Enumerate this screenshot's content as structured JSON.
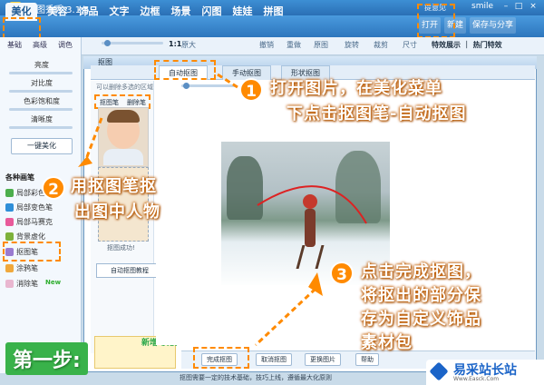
{
  "app": {
    "title": "美图秀秀 3.1.5",
    "user_label": "提意见",
    "user_name": "smile"
  },
  "top_menu": {
    "tabs": [
      "美化",
      "美容",
      "饰品",
      "文字",
      "边框",
      "场景",
      "闪图",
      "娃娃",
      "拼图"
    ],
    "active": "美化"
  },
  "right_tools": {
    "open": "打开",
    "new": "新建",
    "save_share": "保存与分享"
  },
  "toolbar": {
    "scale": "1:1",
    "original": "原大",
    "undo": "撤销",
    "redo": "重做",
    "restore": "原图",
    "rotate": "旋转",
    "crop": "裁剪",
    "size": "尺寸"
  },
  "side_tabs": {
    "recommend": "特效展示 ｜ 热门特效"
  },
  "left_panel": {
    "tabs": [
      "基础",
      "高级",
      "调色"
    ],
    "sliders": [
      "亮度",
      "对比度",
      "色彩饱和度",
      "清晰度"
    ],
    "one_key": "一键美化",
    "brush_title": "各种画笔",
    "brushes": [
      "局部彩色笔",
      "局部变色笔",
      "局部马赛克",
      "背景虚化",
      "抠图笔",
      "涂鸦笔",
      "消除笔"
    ],
    "new_badge": "New"
  },
  "dialog": {
    "title": "抠图",
    "tabs": [
      "自动抠图",
      "手动抠图",
      "形状抠图"
    ],
    "hint": "可以删除多选的区域",
    "sample_tabs": [
      "抠图笔",
      "删除笔"
    ],
    "done_text": "抠图成功!",
    "tutorial": "自动抠图教程",
    "promo": "新增 模板"
  },
  "bottom_bar": {
    "complete": "完成抠图",
    "cancel": "取消抠图",
    "change_bg": "更换图片",
    "other": "帮助"
  },
  "status": "抠图需要一定的技术基础，技巧上线，遵循最大化原则",
  "annotations": {
    "n1": "1",
    "t1_line1": "打开图片，在美化菜单",
    "t1_line2": "下点击抠图笔-自动抠图",
    "n2": "2",
    "t2_line1": "用抠图笔抠",
    "t2_line2": "出图中人物",
    "n3": "3",
    "t3_line1": "点击完成抠图，",
    "t3_line2": "将抠出的部分保",
    "t3_line3": "存为自定义饰品",
    "t3_line4": "素材包",
    "step": "第一步:"
  },
  "watermark": {
    "name": "易采站长站",
    "url": "Www.Easck.Com"
  },
  "colors": {
    "accent": "#ff8a00",
    "brand": "#2d76bd",
    "step_green": "#39b24a"
  }
}
